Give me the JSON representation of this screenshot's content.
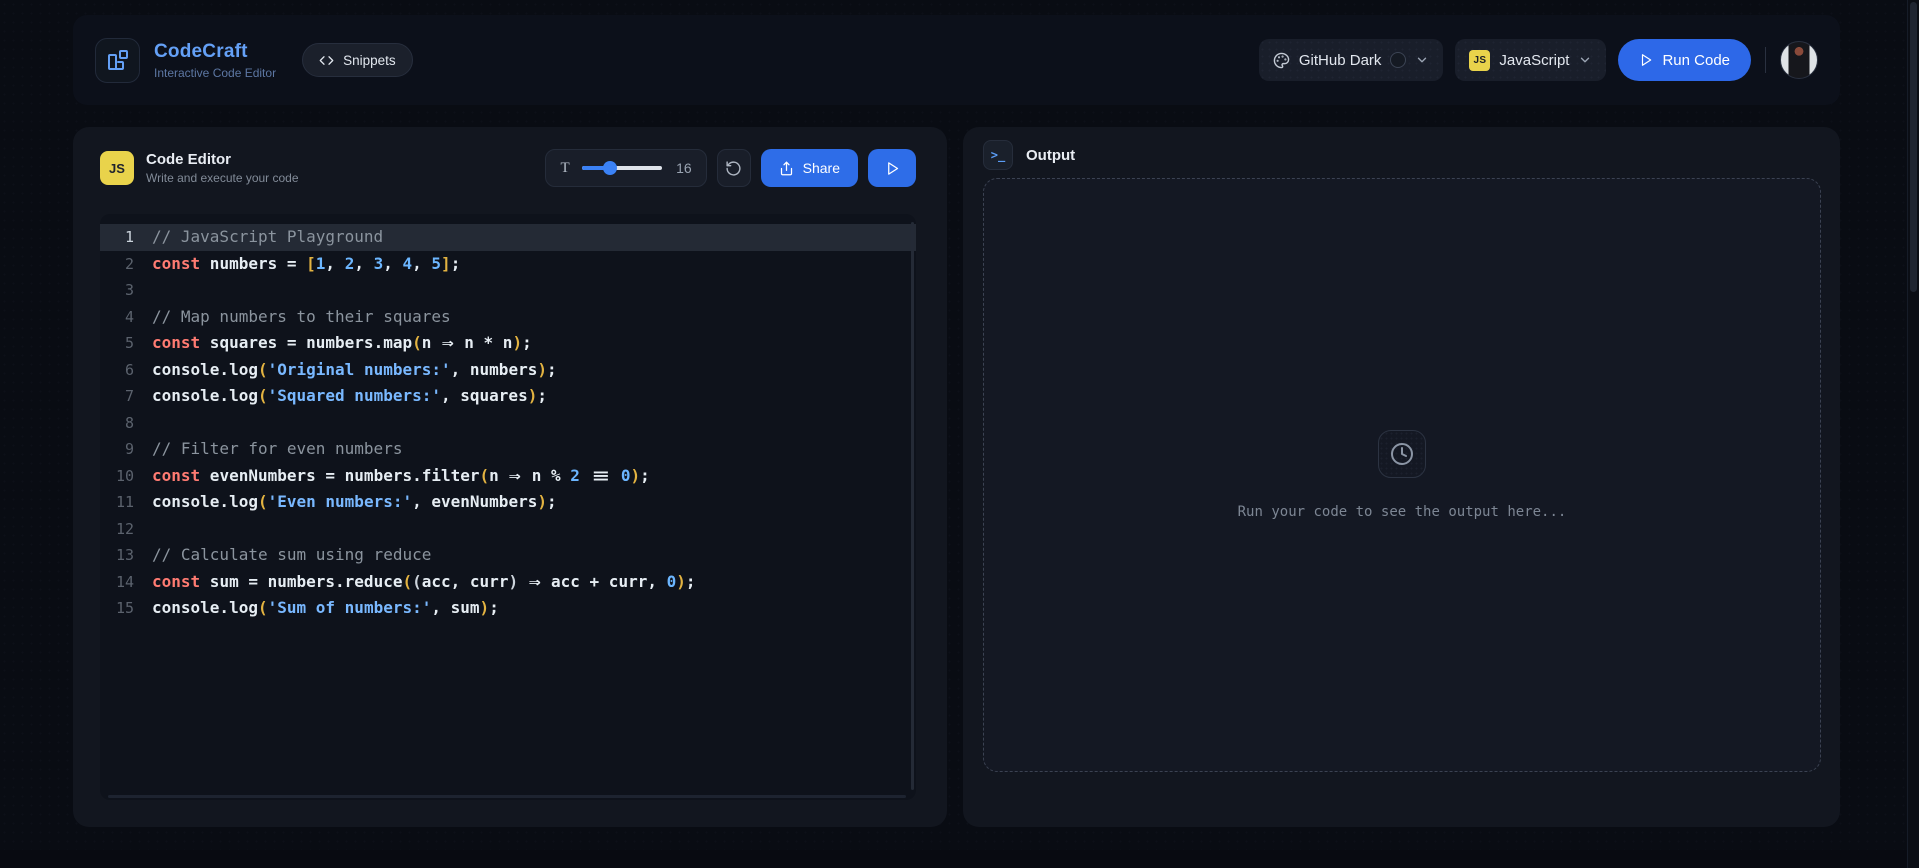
{
  "app": {
    "title": "CodeCraft",
    "subtitle": "Interactive Code Editor"
  },
  "header": {
    "snippets_label": "Snippets",
    "theme_label": "GitHub Dark",
    "language_label": "JavaScript",
    "language_badge": "JS",
    "run_label": "Run Code"
  },
  "editor": {
    "badge": "JS",
    "title": "Code Editor",
    "subtitle": "Write and execute your code",
    "font_tool": "T",
    "font_size": "16",
    "share_label": "Share"
  },
  "output": {
    "title": "Output",
    "terminal_glyph": ">_",
    "empty_message": "Run your code to see the output here..."
  },
  "colors": {
    "accent_blue": "#2e6de8",
    "brand_blue": "#64a0f6",
    "js_yellow": "#e9d34b",
    "keyword": "#ff7b72",
    "string": "#79b8ff",
    "number": "#6cb6ff",
    "bracket": "#e3b341",
    "comment": "#8b949e",
    "page_bg": "#090c13",
    "panel_bg": "#12161f",
    "code_bg": "#0e121b"
  },
  "code": {
    "lines": [
      {
        "n": 1,
        "active": true,
        "tokens": [
          {
            "c": "cmt",
            "v": "// JavaScript Playground"
          }
        ]
      },
      {
        "n": 2,
        "tokens": [
          {
            "c": "kw",
            "v": "const"
          },
          {
            "c": "tx",
            "v": " numbers = "
          },
          {
            "c": "b1",
            "v": "["
          },
          {
            "c": "num",
            "v": "1"
          },
          {
            "c": "tx",
            "v": ", "
          },
          {
            "c": "num",
            "v": "2"
          },
          {
            "c": "tx",
            "v": ", "
          },
          {
            "c": "num",
            "v": "3"
          },
          {
            "c": "tx",
            "v": ", "
          },
          {
            "c": "num",
            "v": "4"
          },
          {
            "c": "tx",
            "v": ", "
          },
          {
            "c": "num",
            "v": "5"
          },
          {
            "c": "b1",
            "v": "]"
          },
          {
            "c": "tx",
            "v": ";"
          }
        ]
      },
      {
        "n": 3,
        "tokens": []
      },
      {
        "n": 4,
        "tokens": [
          {
            "c": "cmt",
            "v": "// Map numbers to their squares"
          }
        ]
      },
      {
        "n": 5,
        "tokens": [
          {
            "c": "kw",
            "v": "const"
          },
          {
            "c": "tx",
            "v": " squares = numbers.map"
          },
          {
            "c": "b1",
            "v": "("
          },
          {
            "c": "tx",
            "v": "n "
          },
          {
            "c": "ar",
            "v": "⇒"
          },
          {
            "c": "tx",
            "v": " n * n"
          },
          {
            "c": "b1",
            "v": ")"
          },
          {
            "c": "tx",
            "v": ";"
          }
        ]
      },
      {
        "n": 6,
        "tokens": [
          {
            "c": "tx",
            "v": "console.log"
          },
          {
            "c": "b1",
            "v": "("
          },
          {
            "c": "str",
            "v": "'Original numbers:'"
          },
          {
            "c": "tx",
            "v": ", numbers"
          },
          {
            "c": "b1",
            "v": ")"
          },
          {
            "c": "tx",
            "v": ";"
          }
        ]
      },
      {
        "n": 7,
        "tokens": [
          {
            "c": "tx",
            "v": "console.log"
          },
          {
            "c": "b1",
            "v": "("
          },
          {
            "c": "str",
            "v": "'Squared numbers:'"
          },
          {
            "c": "tx",
            "v": ", squares"
          },
          {
            "c": "b1",
            "v": ")"
          },
          {
            "c": "tx",
            "v": ";"
          }
        ]
      },
      {
        "n": 8,
        "tokens": []
      },
      {
        "n": 9,
        "tokens": [
          {
            "c": "cmt",
            "v": "// Filter for even numbers"
          }
        ]
      },
      {
        "n": 10,
        "tokens": [
          {
            "c": "kw",
            "v": "const"
          },
          {
            "c": "tx",
            "v": " evenNumbers = numbers.filter"
          },
          {
            "c": "b1",
            "v": "("
          },
          {
            "c": "tx",
            "v": "n "
          },
          {
            "c": "ar",
            "v": "⇒"
          },
          {
            "c": "tx",
            "v": " n % "
          },
          {
            "c": "num",
            "v": "2"
          },
          {
            "c": "tx",
            "v": " "
          },
          {
            "c": "eq",
            "v": "≡"
          },
          {
            "c": "tx",
            "v": " "
          },
          {
            "c": "num",
            "v": "0"
          },
          {
            "c": "b1",
            "v": ")"
          },
          {
            "c": "tx",
            "v": ";"
          }
        ]
      },
      {
        "n": 11,
        "tokens": [
          {
            "c": "tx",
            "v": "console.log"
          },
          {
            "c": "b1",
            "v": "("
          },
          {
            "c": "str",
            "v": "'Even numbers:'"
          },
          {
            "c": "tx",
            "v": ", evenNumbers"
          },
          {
            "c": "b1",
            "v": ")"
          },
          {
            "c": "tx",
            "v": ";"
          }
        ]
      },
      {
        "n": 12,
        "tokens": []
      },
      {
        "n": 13,
        "tokens": [
          {
            "c": "cmt",
            "v": "// Calculate sum using reduce"
          }
        ]
      },
      {
        "n": 14,
        "tokens": [
          {
            "c": "kw",
            "v": "const"
          },
          {
            "c": "tx",
            "v": " sum = numbers.reduce"
          },
          {
            "c": "b1",
            "v": "("
          },
          {
            "c": "b2",
            "v": "("
          },
          {
            "c": "tx",
            "v": "acc, curr"
          },
          {
            "c": "b2",
            "v": ")"
          },
          {
            "c": "tx",
            "v": " "
          },
          {
            "c": "ar",
            "v": "⇒"
          },
          {
            "c": "tx",
            "v": " acc + curr, "
          },
          {
            "c": "num",
            "v": "0"
          },
          {
            "c": "b1",
            "v": ")"
          },
          {
            "c": "tx",
            "v": ";"
          }
        ]
      },
      {
        "n": 15,
        "tokens": [
          {
            "c": "tx",
            "v": "console.log"
          },
          {
            "c": "b1",
            "v": "("
          },
          {
            "c": "str",
            "v": "'Sum of numbers:'"
          },
          {
            "c": "tx",
            "v": ", sum"
          },
          {
            "c": "b1",
            "v": ")"
          },
          {
            "c": "tx",
            "v": ";"
          }
        ]
      }
    ]
  }
}
